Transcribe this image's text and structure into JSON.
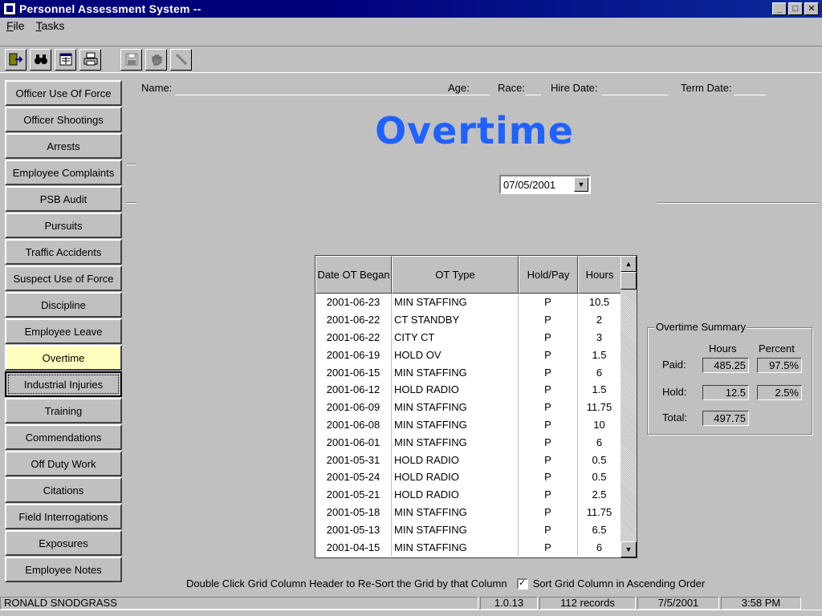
{
  "window": {
    "title": "Personnel Assessment System --",
    "buttons": [
      "_",
      "□",
      "✕"
    ]
  },
  "menu": [
    {
      "first": "F",
      "rest": "ile"
    },
    {
      "first": "T",
      "rest": "asks"
    }
  ],
  "toolbar": {
    "icons": [
      "exit-icon",
      "binoculars-icon",
      "form-icon",
      "printer-icon",
      "save-icon",
      "hand-icon",
      "edit-icon"
    ]
  },
  "sidebar": {
    "items": [
      "Officer Use Of Force",
      "Officer Shootings",
      "Arrests",
      "Employee Complaints",
      "PSB Audit",
      "Pursuits",
      "Traffic Accidents",
      "Suspect Use of Force",
      "Discipline",
      "Employee Leave",
      "Overtime",
      "Industrial Injuries",
      "Training",
      "Commendations",
      "Off Duty Work",
      "Citations",
      "Field Interrogations",
      "Exposures",
      "Employee Notes"
    ],
    "active_index": 10,
    "focused_index": 11
  },
  "header": {
    "name_label": "Name:",
    "age_label": "Age:",
    "race_label": "Race:",
    "hire_label": "Hire Date:",
    "term_label": "Term Date:"
  },
  "page_title": "Overtime",
  "date_select": {
    "value": "07/05/2001"
  },
  "grid": {
    "columns": [
      "Date OT Began",
      "OT Type",
      "Hold/Pay",
      "Hours"
    ],
    "rows": [
      [
        "2001-06-23",
        "MIN STAFFING",
        "P",
        "10.5"
      ],
      [
        "2001-06-22",
        "CT STANDBY",
        "P",
        "2"
      ],
      [
        "2001-06-22",
        "CITY CT",
        "P",
        "3"
      ],
      [
        "2001-06-19",
        "HOLD OV",
        "P",
        "1.5"
      ],
      [
        "2001-06-15",
        "MIN STAFFING",
        "P",
        "6"
      ],
      [
        "2001-06-12",
        "HOLD RADIO",
        "P",
        "1.5"
      ],
      [
        "2001-06-09",
        "MIN STAFFING",
        "P",
        "11.75"
      ],
      [
        "2001-06-08",
        "MIN STAFFING",
        "P",
        "10"
      ],
      [
        "2001-06-01",
        "MIN STAFFING",
        "P",
        "6"
      ],
      [
        "2001-05-31",
        "HOLD RADIO",
        "P",
        "0.5"
      ],
      [
        "2001-05-24",
        "HOLD RADIO",
        "P",
        "0.5"
      ],
      [
        "2001-05-21",
        "HOLD RADIO",
        "P",
        "2.5"
      ],
      [
        "2001-05-18",
        "MIN STAFFING",
        "P",
        "11.75"
      ],
      [
        "2001-05-13",
        "MIN STAFFING",
        "P",
        "6.5"
      ],
      [
        "2001-04-15",
        "MIN STAFFING",
        "P",
        "6"
      ]
    ]
  },
  "summary": {
    "legend": "Overtime Summary",
    "col_hours": "Hours",
    "col_percent": "Percent",
    "paid_label": "Paid:",
    "paid_hours": "485.25",
    "paid_percent": "97.5%",
    "hold_label": "Hold:",
    "hold_hours": "12.5",
    "hold_percent": "2.5%",
    "total_label": "Total:",
    "total_hours": "497.75"
  },
  "footer": {
    "hint": "Double Click Grid Column Header to Re-Sort the Grid by that Column",
    "checkbox_label": "Sort Grid Column in Ascending Order",
    "checked": true
  },
  "status": {
    "user": "RONALD SNODGRASS",
    "version": "1.0.13",
    "records": "112 records",
    "date": "7/5/2001",
    "time": "3:58 PM"
  },
  "colors": {
    "title_blue": "#1f62ff",
    "active_nav": "#ffffc0",
    "titlebar": "#00007b"
  }
}
